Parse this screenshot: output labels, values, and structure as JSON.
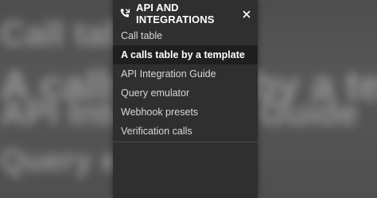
{
  "background": {
    "blurred_lines": [
      "Call table",
      "A calls table by a template",
      "API Integration Guide",
      "Query emulator"
    ]
  },
  "menu": {
    "header_icon": "phone-icon",
    "title": "API AND INTEGRATIONS",
    "close_icon": "close-icon",
    "items": [
      {
        "label": "Call table",
        "active": false
      },
      {
        "label": "A calls table by a template",
        "active": true
      },
      {
        "label": "API Integration Guide",
        "active": false
      },
      {
        "label": "Query emulator",
        "active": false
      },
      {
        "label": "Webhook presets",
        "active": false
      },
      {
        "label": "Verification calls",
        "active": false
      }
    ]
  },
  "colors": {
    "panel_bg": "#2f2f2f",
    "active_bg": "#1f1f1f",
    "text": "#d8d8d8",
    "active_text": "#ffffff"
  }
}
